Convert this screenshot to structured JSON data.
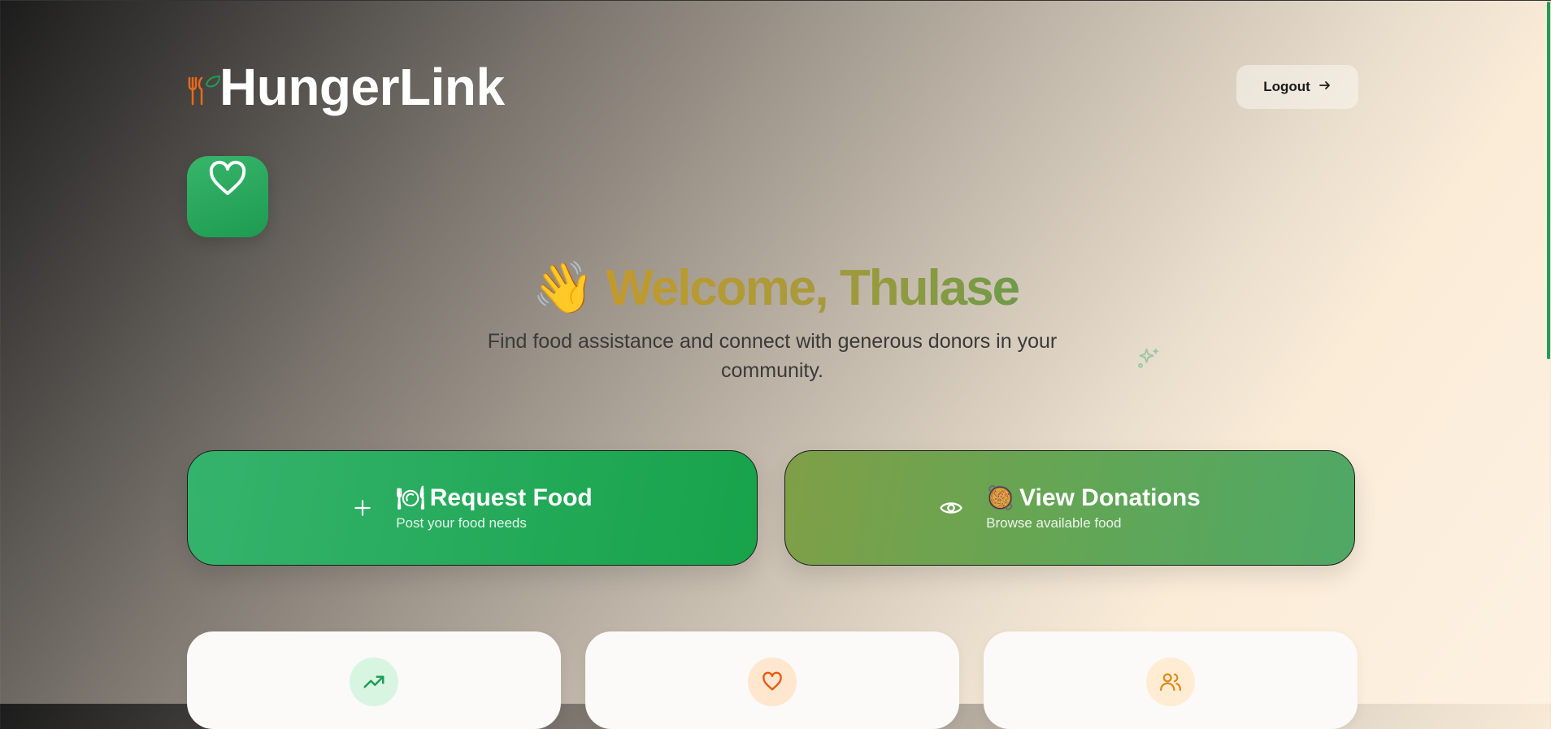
{
  "app": {
    "name": "HungerLink"
  },
  "header": {
    "logout_label": "Logout"
  },
  "hero": {
    "wave_emoji": "👋",
    "welcome_text": "Welcome, Thulase",
    "subtitle": "Find food assistance and connect with generous donors in your community."
  },
  "actions": [
    {
      "emoji": "🍽",
      "title": "Request Food",
      "subtitle": "Post your food needs",
      "icon": "plus-icon"
    },
    {
      "emoji": "🥘",
      "title": "View Donations",
      "subtitle": "Browse available food",
      "icon": "eye-icon"
    }
  ],
  "stat_cards": [
    {
      "icon": "trending-up-icon",
      "color": "#1f9d55",
      "bg": "#d8f5e2"
    },
    {
      "icon": "heart-icon",
      "color": "#ea580c",
      "bg": "#ffe6cf"
    },
    {
      "icon": "users-icon",
      "color": "#e08a1a",
      "bg": "#ffecd2"
    }
  ],
  "colors": {
    "brand_green": "#1f9d55",
    "accent_orange": "#ea6a1a"
  }
}
